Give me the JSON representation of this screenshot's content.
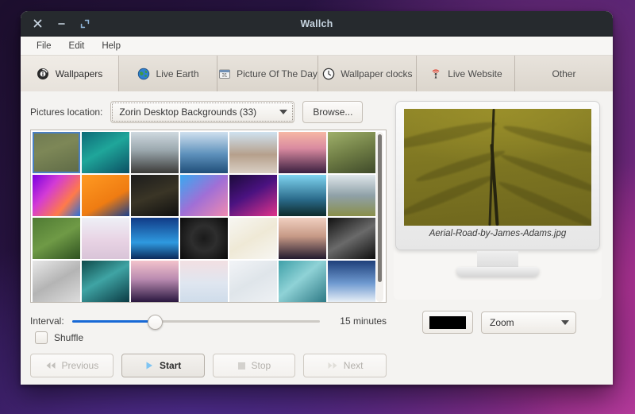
{
  "window": {
    "title": "Wallch",
    "controls": [
      {
        "name": "close",
        "glyph": "✕"
      },
      {
        "name": "minimize",
        "glyph": "−"
      },
      {
        "name": "maximize",
        "glyph": "⤡"
      }
    ]
  },
  "menubar": {
    "items": [
      {
        "label": "File"
      },
      {
        "label": "Edit"
      },
      {
        "label": "Help"
      }
    ]
  },
  "tabs": [
    {
      "label": "Wallpapers",
      "icon": "wallpapers-icon",
      "active": true
    },
    {
      "label": "Live Earth",
      "icon": "globe-icon",
      "active": false
    },
    {
      "label": "Picture Of The Day",
      "icon": "calendar-icon",
      "active": false
    },
    {
      "label": "Wallpaper clocks",
      "icon": "clock-icon",
      "active": false
    },
    {
      "label": "Live Website",
      "icon": "broadcast-icon",
      "active": false
    },
    {
      "label": "Other",
      "icon": "",
      "active": false
    }
  ],
  "location": {
    "label": "Pictures location:",
    "selected": "Zorin Desktop Backgrounds (33)",
    "browse_label": "Browse..."
  },
  "grid": {
    "selected_index": 0,
    "thumbnails": [
      {
        "name": "aerial-road",
        "css": "linear-gradient(160deg,#6f7a52 0%,#7d8757 40%,#5e6a46 100%)"
      },
      {
        "name": "teal-wave",
        "css": "linear-gradient(150deg,#0d6a77 0%,#1fa69a 45%,#0b4f63 100%)"
      },
      {
        "name": "beach-walk",
        "css": "linear-gradient(180deg,#cfd9e0 0%,#9aa7ad 45%,#3b3a38 100%)"
      },
      {
        "name": "ocean-horizon",
        "css": "linear-gradient(180deg,#cfe0ef 0%,#5c8fba 55%,#1f4e78 100%)"
      },
      {
        "name": "desert-buttes",
        "css": "linear-gradient(180deg,#cfe2f0 0%,#b6a08c 55%,#d9cfc4 100%)"
      },
      {
        "name": "city-sunset",
        "css": "linear-gradient(180deg,#f6b7a4 0%,#d98aa0 40%,#3a1f3f 100%)"
      },
      {
        "name": "waterfall-cliff",
        "css": "linear-gradient(160deg,#9fb06a 0%,#6f7d45 50%,#3f4a2a 100%)"
      },
      {
        "name": "prism-abstract",
        "css": "linear-gradient(130deg,#7a00e0 0%,#d33bd6 35%,#ff7a4a 70%,#2b6fd8 100%)"
      },
      {
        "name": "orange-droplets",
        "css": "linear-gradient(150deg,#ff9a22 0%,#ef7c12 60%,#1b3f8a 100%)"
      },
      {
        "name": "dark-feather",
        "css": "linear-gradient(160deg,#1c1c1c 0%,#3a3526 50%,#0f0f0f 100%)"
      },
      {
        "name": "blue-pink-wave",
        "css": "linear-gradient(140deg,#39a9f0 0%,#a06fd6 50%,#f08ab0 100%)"
      },
      {
        "name": "violet-wave",
        "css": "linear-gradient(150deg,#1b0b3a 0%,#4a1280 45%,#e0338a 100%)"
      },
      {
        "name": "palm-sky",
        "css": "linear-gradient(180deg,#7fd4f0 0%,#2a6a8a 60%,#0e2a2a 100%)"
      },
      {
        "name": "mountain-lake",
        "css": "linear-gradient(180deg,#dfe6ea 0%,#8fa1a8 50%,#8a8f4a 100%)"
      },
      {
        "name": "green-leaf",
        "css": "linear-gradient(150deg,#4f7a33 0%,#6f9a46 50%,#2f5220 100%)"
      },
      {
        "name": "pink-clouds",
        "css": "linear-gradient(180deg,#eef0f6 0%,#e8d3e4 55%,#d9c4d8 100%)"
      },
      {
        "name": "blue-crystal",
        "css": "linear-gradient(180deg,#103a86 0%,#2f9ae0 60%,#0c2a5a 100%)"
      },
      {
        "name": "black-vortex",
        "css": "radial-gradient(circle at 50% 50%,#1a1a1a 0%,#2e2e2e 40%,#0a0a0a 100%)"
      },
      {
        "name": "yellow-splatter",
        "css": "linear-gradient(150deg,#f7f6f2 0%,#efe9d6 50%,#f7f6f2 100%)"
      },
      {
        "name": "desert-dusk",
        "css": "linear-gradient(180deg,#f0cfc0 0%,#c79a86 45%,#221a2e 100%)"
      },
      {
        "name": "grey-fabric",
        "css": "linear-gradient(150deg,#111111 0%,#6a6a6a 50%,#0e0e0e 100%)"
      },
      {
        "name": "white-mesh",
        "css": "linear-gradient(150deg,#e8e8e8 0%,#b4b4b4 50%,#dcdcdc 100%)"
      },
      {
        "name": "ice-cave",
        "css": "linear-gradient(150deg,#0e4a4a 0%,#3fa4a4 45%,#0b3b44 100%)"
      },
      {
        "name": "lighthouse",
        "css": "linear-gradient(180deg,#f3c3cc 0%,#b98ab0 45%,#2b1840 100%)"
      },
      {
        "name": "pastel-snow",
        "css": "linear-gradient(180deg,#f2dfe2 0%,#dfe6f0 55%,#cfdcea 100%)"
      },
      {
        "name": "silk-white",
        "css": "linear-gradient(150deg,#f2f4f7 0%,#dfe5ea 50%,#eef1f4 100%)"
      },
      {
        "name": "teal-streaks",
        "css": "linear-gradient(140deg,#3fa0a8 0%,#8fd2d6 45%,#2e7a86 100%)"
      },
      {
        "name": "snow-peak",
        "css": "linear-gradient(180deg,#1e3f7a 0%,#6f9ad0 55%,#e6eef6 100%)"
      }
    ]
  },
  "interval": {
    "label": "Interval:",
    "value_text": "15 minutes",
    "percent": 33
  },
  "shuffle": {
    "label": "Shuffle",
    "checked": false
  },
  "controls": [
    {
      "label": "Previous",
      "icon": "prev-icon",
      "enabled": false
    },
    {
      "label": "Start",
      "icon": "play-icon",
      "enabled": true
    },
    {
      "label": "Stop",
      "icon": "stop-icon",
      "enabled": false
    },
    {
      "label": "Next",
      "icon": "next-icon",
      "enabled": false
    }
  ],
  "preview": {
    "filename": "Aerial-Road-by-James-Adams.jpg",
    "background_color": "#000000",
    "style_selected": "Zoom"
  },
  "colors": {
    "accent": "#1769d6",
    "selection": "#4a7fc1",
    "titlebar": "#262a2e",
    "title_text": "#c6d4e0"
  }
}
